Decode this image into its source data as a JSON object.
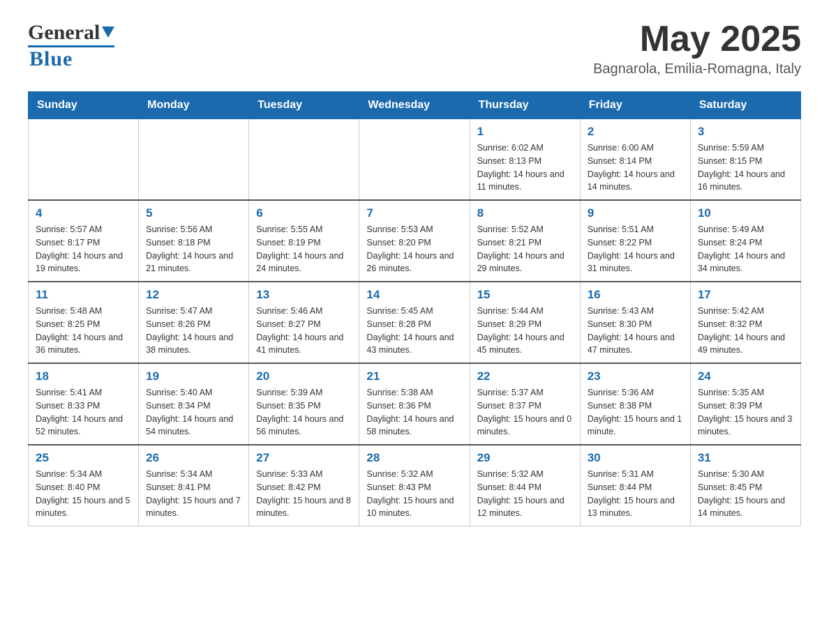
{
  "header": {
    "logo_general": "General",
    "logo_blue": "Blue",
    "month_title": "May 2025",
    "location": "Bagnarola, Emilia-Romagna, Italy"
  },
  "days_of_week": [
    "Sunday",
    "Monday",
    "Tuesday",
    "Wednesday",
    "Thursday",
    "Friday",
    "Saturday"
  ],
  "weeks": [
    [
      {
        "day": "",
        "info": ""
      },
      {
        "day": "",
        "info": ""
      },
      {
        "day": "",
        "info": ""
      },
      {
        "day": "",
        "info": ""
      },
      {
        "day": "1",
        "info": "Sunrise: 6:02 AM\nSunset: 8:13 PM\nDaylight: 14 hours and 11 minutes."
      },
      {
        "day": "2",
        "info": "Sunrise: 6:00 AM\nSunset: 8:14 PM\nDaylight: 14 hours and 14 minutes."
      },
      {
        "day": "3",
        "info": "Sunrise: 5:59 AM\nSunset: 8:15 PM\nDaylight: 14 hours and 16 minutes."
      }
    ],
    [
      {
        "day": "4",
        "info": "Sunrise: 5:57 AM\nSunset: 8:17 PM\nDaylight: 14 hours and 19 minutes."
      },
      {
        "day": "5",
        "info": "Sunrise: 5:56 AM\nSunset: 8:18 PM\nDaylight: 14 hours and 21 minutes."
      },
      {
        "day": "6",
        "info": "Sunrise: 5:55 AM\nSunset: 8:19 PM\nDaylight: 14 hours and 24 minutes."
      },
      {
        "day": "7",
        "info": "Sunrise: 5:53 AM\nSunset: 8:20 PM\nDaylight: 14 hours and 26 minutes."
      },
      {
        "day": "8",
        "info": "Sunrise: 5:52 AM\nSunset: 8:21 PM\nDaylight: 14 hours and 29 minutes."
      },
      {
        "day": "9",
        "info": "Sunrise: 5:51 AM\nSunset: 8:22 PM\nDaylight: 14 hours and 31 minutes."
      },
      {
        "day": "10",
        "info": "Sunrise: 5:49 AM\nSunset: 8:24 PM\nDaylight: 14 hours and 34 minutes."
      }
    ],
    [
      {
        "day": "11",
        "info": "Sunrise: 5:48 AM\nSunset: 8:25 PM\nDaylight: 14 hours and 36 minutes."
      },
      {
        "day": "12",
        "info": "Sunrise: 5:47 AM\nSunset: 8:26 PM\nDaylight: 14 hours and 38 minutes."
      },
      {
        "day": "13",
        "info": "Sunrise: 5:46 AM\nSunset: 8:27 PM\nDaylight: 14 hours and 41 minutes."
      },
      {
        "day": "14",
        "info": "Sunrise: 5:45 AM\nSunset: 8:28 PM\nDaylight: 14 hours and 43 minutes."
      },
      {
        "day": "15",
        "info": "Sunrise: 5:44 AM\nSunset: 8:29 PM\nDaylight: 14 hours and 45 minutes."
      },
      {
        "day": "16",
        "info": "Sunrise: 5:43 AM\nSunset: 8:30 PM\nDaylight: 14 hours and 47 minutes."
      },
      {
        "day": "17",
        "info": "Sunrise: 5:42 AM\nSunset: 8:32 PM\nDaylight: 14 hours and 49 minutes."
      }
    ],
    [
      {
        "day": "18",
        "info": "Sunrise: 5:41 AM\nSunset: 8:33 PM\nDaylight: 14 hours and 52 minutes."
      },
      {
        "day": "19",
        "info": "Sunrise: 5:40 AM\nSunset: 8:34 PM\nDaylight: 14 hours and 54 minutes."
      },
      {
        "day": "20",
        "info": "Sunrise: 5:39 AM\nSunset: 8:35 PM\nDaylight: 14 hours and 56 minutes."
      },
      {
        "day": "21",
        "info": "Sunrise: 5:38 AM\nSunset: 8:36 PM\nDaylight: 14 hours and 58 minutes."
      },
      {
        "day": "22",
        "info": "Sunrise: 5:37 AM\nSunset: 8:37 PM\nDaylight: 15 hours and 0 minutes."
      },
      {
        "day": "23",
        "info": "Sunrise: 5:36 AM\nSunset: 8:38 PM\nDaylight: 15 hours and 1 minute."
      },
      {
        "day": "24",
        "info": "Sunrise: 5:35 AM\nSunset: 8:39 PM\nDaylight: 15 hours and 3 minutes."
      }
    ],
    [
      {
        "day": "25",
        "info": "Sunrise: 5:34 AM\nSunset: 8:40 PM\nDaylight: 15 hours and 5 minutes."
      },
      {
        "day": "26",
        "info": "Sunrise: 5:34 AM\nSunset: 8:41 PM\nDaylight: 15 hours and 7 minutes."
      },
      {
        "day": "27",
        "info": "Sunrise: 5:33 AM\nSunset: 8:42 PM\nDaylight: 15 hours and 8 minutes."
      },
      {
        "day": "28",
        "info": "Sunrise: 5:32 AM\nSunset: 8:43 PM\nDaylight: 15 hours and 10 minutes."
      },
      {
        "day": "29",
        "info": "Sunrise: 5:32 AM\nSunset: 8:44 PM\nDaylight: 15 hours and 12 minutes."
      },
      {
        "day": "30",
        "info": "Sunrise: 5:31 AM\nSunset: 8:44 PM\nDaylight: 15 hours and 13 minutes."
      },
      {
        "day": "31",
        "info": "Sunrise: 5:30 AM\nSunset: 8:45 PM\nDaylight: 15 hours and 14 minutes."
      }
    ]
  ]
}
